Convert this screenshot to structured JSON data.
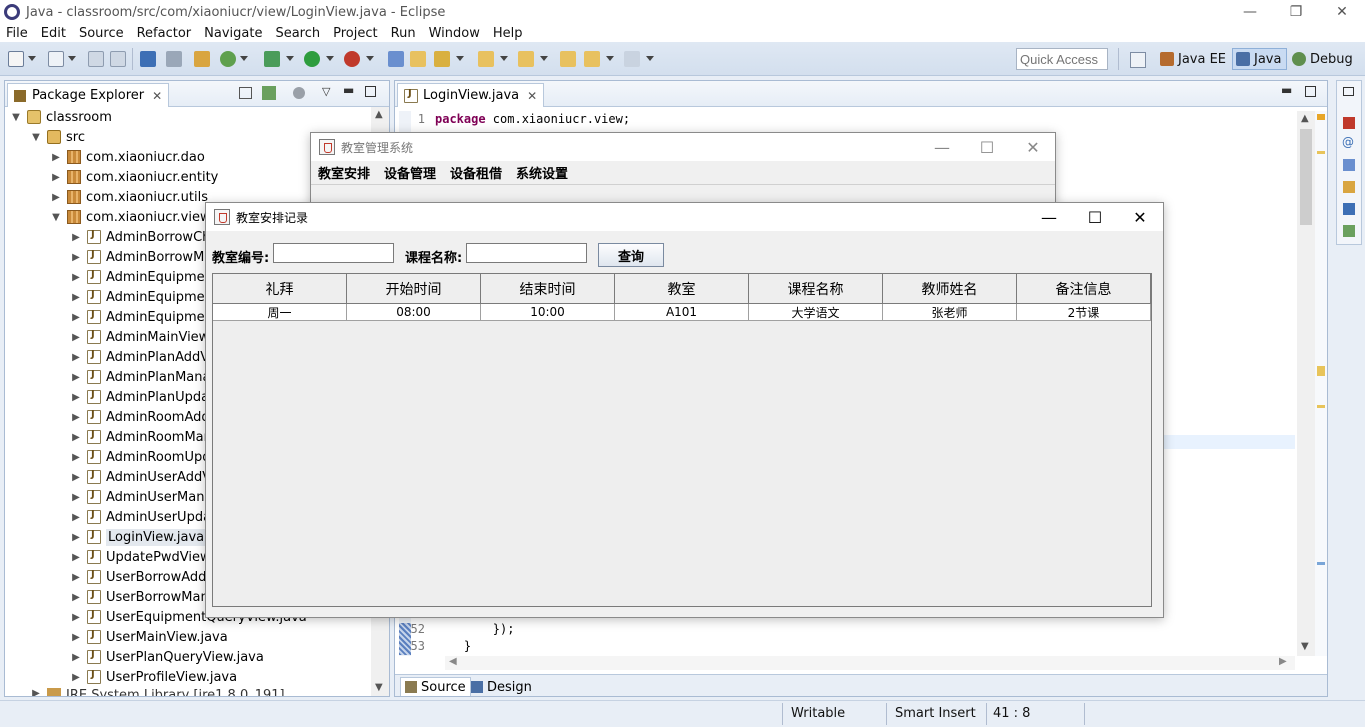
{
  "window": {
    "title": "Java - classroom/src/com/xiaoniucr/view/LoginView.java - Eclipse",
    "minimize": "—",
    "maximize": "❐",
    "close": "✕"
  },
  "menu": [
    "File",
    "Edit",
    "Source",
    "Refactor",
    "Navigate",
    "Search",
    "Project",
    "Run",
    "Window",
    "Help"
  ],
  "toolbar": {
    "quick_access_placeholder": "Quick Access",
    "perspectives": [
      "Java EE",
      "Java",
      "Debug"
    ]
  },
  "package_explorer": {
    "tab_label": "Package Explorer",
    "tab_close": "✕",
    "project": "classroom",
    "src_folder": "src",
    "packages": [
      "com.xiaoniucr.dao",
      "com.xiaoniucr.entity",
      "com.xiaoniucr.utils",
      "com.xiaoniucr.view"
    ],
    "files": [
      "AdminBorrowChe",
      "AdminBorrowMa",
      "AdminEquipment",
      "AdminEquipment",
      "AdminEquipment",
      "AdminMainView.j",
      "AdminPlanAddVie",
      "AdminPlanManag",
      "AdminPlanUpdate",
      "AdminRoomAddV",
      "AdminRoomMan",
      "AdminRoomUpda",
      "AdminUserAddVi",
      "AdminUserManag",
      "AdminUserUpdat",
      "LoginView.java",
      "UpdatePwdView.j",
      "UserBorrowAddV",
      "UserBorrowMana",
      "UserEquipmentQueryView.java",
      "UserMainView.java",
      "UserPlanQueryView.java",
      "UserProfileView.java"
    ],
    "library_partial": "JRE System Library [jre1.8.0_191]"
  },
  "editor": {
    "tab_label": "LoginView.java",
    "tab_close": "✕",
    "lines": [
      {
        "num": "1",
        "kw": "package",
        "text": " com.xiaoniucr.view;"
      },
      {
        "num": "52",
        "kw": "",
        "text": "        });"
      },
      {
        "num": "53",
        "kw": "",
        "text": "    }"
      }
    ],
    "bottom_tabs": [
      "Source",
      "Design"
    ]
  },
  "status": {
    "writable": "Writable",
    "insert_mode": "Smart Insert",
    "position": "41 : 8"
  },
  "main_window": {
    "title": "教室管理系统",
    "menu": [
      "教室安排",
      "设备管理",
      "设备租借",
      "系统设置"
    ],
    "minimize": "—",
    "maximize": "☐",
    "close": "✕"
  },
  "record_window": {
    "title": "教室安排记录",
    "minimize": "—",
    "maximize": "☐",
    "close": "✕",
    "room_label": "教室编号:",
    "room_value": "",
    "course_label": "课程名称:",
    "course_value": "",
    "query_button": "查询",
    "columns": [
      "礼拜",
      "开始时间",
      "结束时间",
      "教室",
      "课程名称",
      "教师姓名",
      "备注信息"
    ],
    "rows": [
      [
        "周一",
        "08:00",
        "10:00",
        "A101",
        "大学语文",
        "张老师",
        "2节课"
      ]
    ]
  }
}
